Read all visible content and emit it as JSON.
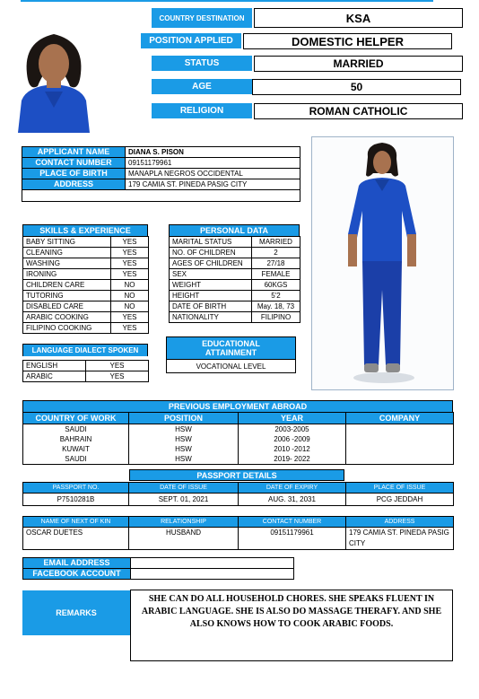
{
  "header": {
    "country_destination_label": "COUNTRY DESTINATION",
    "country_destination": "KSA",
    "position_applied_label": "POSITION APPLIED",
    "position_applied": "DOMESTIC HELPER",
    "status_label": "STATUS",
    "status": "MARRIED",
    "age_label": "AGE",
    "age": "50",
    "religion_label": "RELIGION",
    "religion": "ROMAN CATHOLIC"
  },
  "applicant": {
    "name_label": "APPLICANT NAME",
    "name": "DIANA S.  PISON",
    "contact_label": "CONTACT NUMBER",
    "contact": "09151179961",
    "birthplace_label": "PLACE OF BIRTH",
    "birthplace": "MANAPLA NEGROS OCCIDENTAL",
    "address_label": "ADDRESS",
    "address": "179 CAMIA ST. PINEDA PASIG CITY"
  },
  "skills": {
    "title": "SKILLS & EXPERIENCE",
    "rows": [
      [
        "BABY SITTING",
        "YES"
      ],
      [
        "CLEANING",
        "YES"
      ],
      [
        "WASHING",
        "YES"
      ],
      [
        "IRONING",
        "YES"
      ],
      [
        "CHILDREN CARE",
        "NO"
      ],
      [
        "TUTORING",
        "NO"
      ],
      [
        "DISABLED CARE",
        "NO"
      ],
      [
        "ARABIC COOKING",
        "YES"
      ],
      [
        "FILIPINO COOKING",
        "YES"
      ]
    ]
  },
  "personal": {
    "title": "PERSONAL DATA",
    "rows": [
      [
        "MARITAL STATUS",
        "MARRIED"
      ],
      [
        "NO. OF CHILDREN",
        "2"
      ],
      [
        "AGES OF CHILDREN",
        "27/18"
      ],
      [
        "SEX",
        "FEMALE"
      ],
      [
        "WEIGHT",
        "60KGS"
      ],
      [
        "HEIGHT",
        "5'2"
      ],
      [
        "DATE OF BIRTH",
        "May. 18, 73"
      ],
      [
        "NATIONALITY",
        "FILIPINO"
      ]
    ]
  },
  "language": {
    "title": "LANGUAGE DIALECT SPOKEN",
    "rows": [
      [
        "ENGLISH",
        "YES"
      ],
      [
        "ARABIC",
        "YES"
      ]
    ]
  },
  "education": {
    "title": "EDUCATIONAL ATTAINMENT",
    "value": "VOCATIONAL LEVEL"
  },
  "employment": {
    "title": "PREVIOUS EMPLOYMENT ABROAD",
    "headers": [
      "COUNTRY OF WORK",
      "POSITION",
      "YEAR",
      "COMPANY"
    ],
    "rows": [
      [
        "SAUDI",
        "HSW",
        "2003-2005",
        ""
      ],
      [
        "BAHRAIN",
        "HSW",
        "2006 -2009",
        ""
      ],
      [
        "KUWAIT",
        "HSW",
        "2010 -2012",
        ""
      ],
      [
        "SAUDI",
        "HSW",
        "2019- 2022",
        ""
      ]
    ]
  },
  "passport": {
    "title": "PASSPORT DETAILS",
    "headers": [
      "PASSPORT NO.",
      "DATE OF ISSUE",
      "DATE OF EXPIRY",
      "PLACE OF ISSUE"
    ],
    "values": [
      "P7510281B",
      "SEPT. 01, 2021",
      "AUG. 31, 2031",
      "PCG JEDDAH"
    ]
  },
  "kin": {
    "headers": [
      "NAME OF NEXT OF KIN",
      "RELATIONSHIP",
      "CONTACT NUMBER",
      "ADDRESS"
    ],
    "values": [
      "OSCAR DUETES",
      "HUSBAND",
      "09151179961",
      "179 CAMIA ST. PINEDA PASIG CITY"
    ]
  },
  "contact": {
    "email_label": "EMAIL ADDRESS",
    "email": "",
    "facebook_label": "FACEBOOK ACCOUNT",
    "facebook": ""
  },
  "remarks": {
    "label": "REMARKS",
    "text": "SHE CAN DO ALL HOUSEHOLD CHORES. SHE SPEAKS FLUENT IN ARABIC LANGUAGE. SHE IS ALSO DO MASSAGE THERAFY. AND SHE ALSO KNOWS HOW TO COOK ARABIC FOODS."
  },
  "colors": {
    "accent": "#1a9be6",
    "uniform": "#1d4fc4"
  }
}
